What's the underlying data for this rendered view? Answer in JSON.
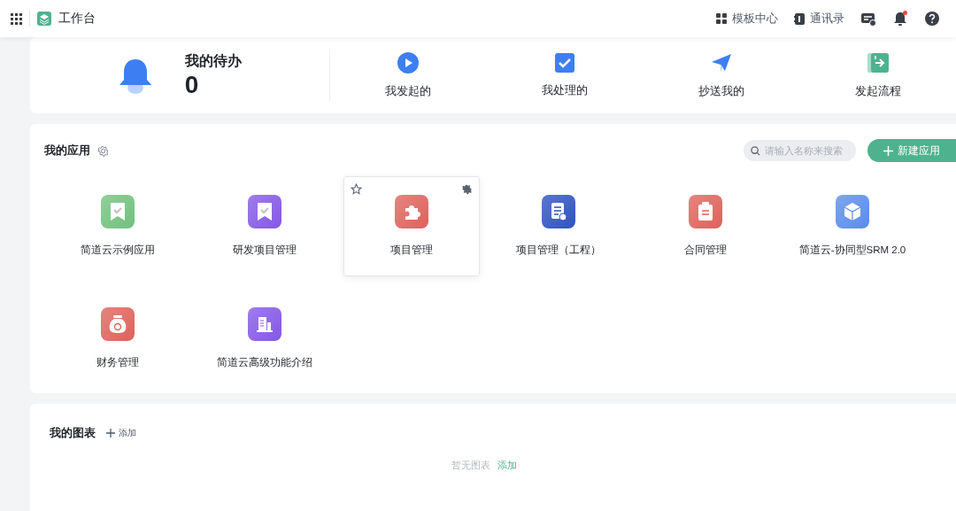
{
  "header": {
    "app_title": "工作台",
    "links": [
      {
        "label": "模板中心",
        "kind": "template"
      },
      {
        "label": "通讯录",
        "kind": "contacts"
      }
    ],
    "notification_dot": true
  },
  "todo": {
    "title": "我的待办",
    "count": "0"
  },
  "shortcuts": [
    {
      "label": "我发起的",
      "kind": "started"
    },
    {
      "label": "我处理的",
      "kind": "handled"
    },
    {
      "label": "抄送我的",
      "kind": "copied"
    },
    {
      "label": "发起流程",
      "kind": "launch"
    }
  ],
  "apps": {
    "title": "我的应用",
    "search": {
      "placeholder": "请输入名称来搜索"
    },
    "new_button": "新建应用",
    "items": [
      {
        "name": "简道云示例应用",
        "color": "#72c17e",
        "kind": "ribbon",
        "hovered": false
      },
      {
        "name": "研发项目管理",
        "color": "#8458e6",
        "kind": "ribbon",
        "hovered": false
      },
      {
        "name": "项目管理",
        "color": "#de625c",
        "kind": "puzzle",
        "hovered": true
      },
      {
        "name": "项目管理（工程）",
        "color": "#2d52c2",
        "kind": "document",
        "hovered": false
      },
      {
        "name": "合同管理",
        "color": "#de625c",
        "kind": "clipboard",
        "hovered": false
      },
      {
        "name": "简道云-协同型SRM 2.0",
        "color": "#5a8ceb",
        "kind": "cube",
        "hovered": false
      },
      {
        "name": "财务管理",
        "color": "#de625c",
        "kind": "money",
        "hovered": false
      },
      {
        "name": "简道云高级功能介绍",
        "color": "#8458e6",
        "kind": "building",
        "hovered": false
      }
    ]
  },
  "charts": {
    "title": "我的图表",
    "add_label": "添加",
    "empty_text": "暂无图表",
    "empty_link": "添加"
  }
}
